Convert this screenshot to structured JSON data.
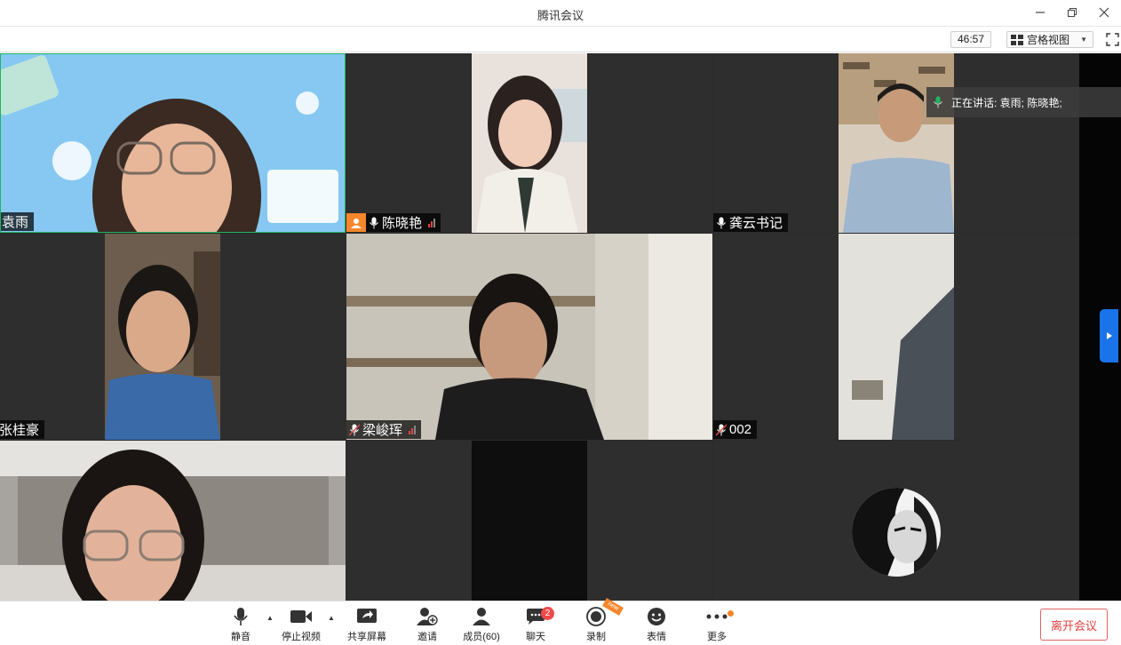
{
  "window": {
    "title": "腾讯会议",
    "minimize_icon": "minimize-icon",
    "restore_icon": "restore-icon",
    "close_icon": "close-icon"
  },
  "header": {
    "timer": "46:57",
    "view_mode": "宫格视图"
  },
  "speaking_popup": {
    "text": "正在讲话: 袁雨; 陈晓艳;"
  },
  "participants": [
    {
      "name": "袁雨"
    },
    {
      "name": "陈晓艳"
    },
    {
      "name": "龚云书记"
    },
    {
      "name": "张桂豪"
    },
    {
      "name": "梁峻珲"
    },
    {
      "name": "002"
    },
    {
      "name": ""
    },
    {
      "name": ""
    },
    {
      "name": ""
    }
  ],
  "toolbar": {
    "mute": "静音",
    "stop_video": "停止视频",
    "share_screen": "共享屏幕",
    "invite": "邀请",
    "members": "成员(60)",
    "chat": "聊天",
    "chat_badge": "2",
    "record": "录制",
    "record_tag": "new",
    "reactions": "表情",
    "more": "更多",
    "leave": "离开会议"
  },
  "colors": {
    "accent": "#1a73e8",
    "leave": "#e04040",
    "badge": "#f04a4a",
    "host": "#f5862b",
    "active_speaker_border": "#1fb660"
  }
}
